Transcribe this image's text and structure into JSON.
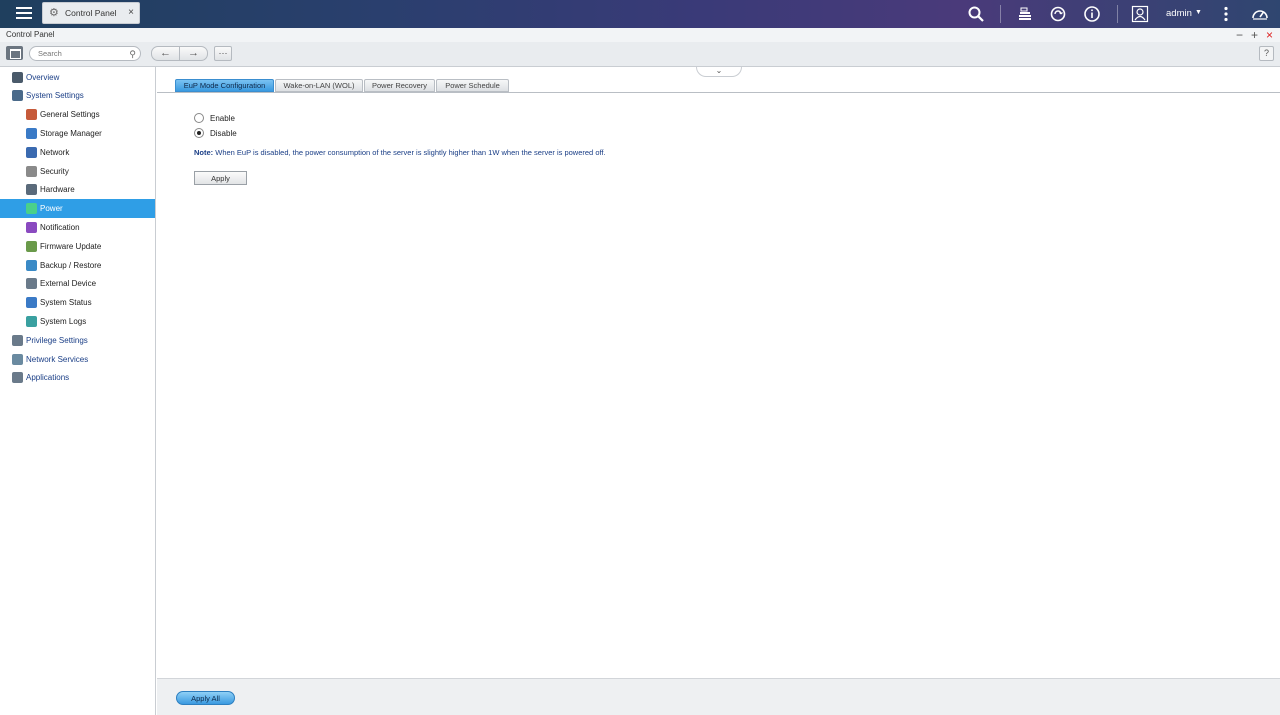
{
  "topbar": {
    "app_tab": {
      "label": "Control Panel",
      "icon": "gear-icon",
      "close": "×"
    },
    "user": "admin",
    "icons": [
      "search-icon",
      "stack-icon",
      "sync-icon",
      "info-icon",
      "user-icon",
      "more-icon",
      "dashboard-icon"
    ]
  },
  "window": {
    "title": "Control Panel",
    "controls": {
      "minimize": "−",
      "maximize": "+",
      "close": "×"
    }
  },
  "toolbar": {
    "search_placeholder": "Search",
    "back": "←",
    "forward": "→",
    "help": "?"
  },
  "sidebar": {
    "items": [
      {
        "label": "Overview",
        "icon": "overview-icon",
        "level": 0,
        "active": false
      },
      {
        "label": "System Settings",
        "icon": "gear-icon",
        "level": 0,
        "active": false
      },
      {
        "label": "General Settings",
        "icon": "general-settings-icon",
        "level": 1,
        "active": false
      },
      {
        "label": "Storage Manager",
        "icon": "storage-icon",
        "level": 1,
        "active": false
      },
      {
        "label": "Network",
        "icon": "network-icon",
        "level": 1,
        "active": false
      },
      {
        "label": "Security",
        "icon": "lock-icon",
        "level": 1,
        "active": false
      },
      {
        "label": "Hardware",
        "icon": "hardware-icon",
        "level": 1,
        "active": false
      },
      {
        "label": "Power",
        "icon": "power-icon",
        "level": 1,
        "active": true
      },
      {
        "label": "Notification",
        "icon": "notification-icon",
        "level": 1,
        "active": false
      },
      {
        "label": "Firmware Update",
        "icon": "firmware-icon",
        "level": 1,
        "active": false
      },
      {
        "label": "Backup / Restore",
        "icon": "backup-icon",
        "level": 1,
        "active": false
      },
      {
        "label": "External Device",
        "icon": "external-device-icon",
        "level": 1,
        "active": false
      },
      {
        "label": "System Status",
        "icon": "monitor-icon",
        "level": 1,
        "active": false
      },
      {
        "label": "System Logs",
        "icon": "logs-icon",
        "level": 1,
        "active": false
      },
      {
        "label": "Privilege Settings",
        "icon": "user-icon",
        "level": 0,
        "active": false
      },
      {
        "label": "Network Services",
        "icon": "globe-icon",
        "level": 0,
        "active": false
      },
      {
        "label": "Applications",
        "icon": "applications-icon",
        "level": 0,
        "active": false
      }
    ]
  },
  "main": {
    "tabs": [
      {
        "label": "EuP Mode Configuration",
        "active": true
      },
      {
        "label": "Wake-on-LAN (WOL)",
        "active": false
      },
      {
        "label": "Power Recovery",
        "active": false
      },
      {
        "label": "Power Schedule",
        "active": false
      }
    ],
    "options": [
      {
        "label": "Enable",
        "checked": false
      },
      {
        "label": "Disable",
        "checked": true
      }
    ],
    "note_prefix": "Note:",
    "note_text": " When EuP is disabled, the power consumption of the server is slightly higher than 1W when the server is powered off.",
    "apply_label": "Apply"
  },
  "footer": {
    "apply_all_label": "Apply All"
  },
  "colors": {
    "accent": "#2f9ee6",
    "link_blue": "#1a3e86",
    "close_red": "#dd2222"
  }
}
